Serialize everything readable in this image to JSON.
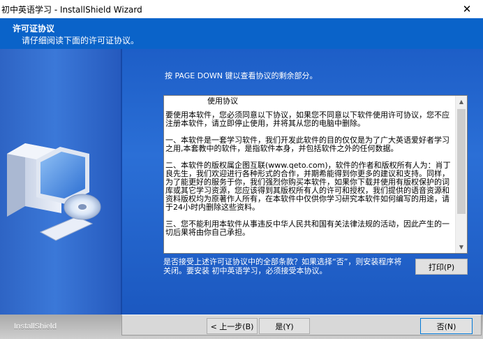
{
  "window": {
    "title": "初中英语学习 - InstallShield Wizard",
    "close_glyph": "✕"
  },
  "header": {
    "title": "许可证协议",
    "subtitle": "请仔细阅读下面的许可证协议。"
  },
  "main": {
    "instruction": "按 PAGE DOWN 键以查看协议的剩余部分。",
    "license": {
      "heading": "使用协议",
      "paragraphs": [
        "要使用本软件，您必须同意以下协议，如果您不同意以下软件使用许可协议，您不应注册本软件，请立即停止使用，并将其从您的电脑中删除。",
        "一、本软件是一套学习软件，我们开发此软件的目的仅仅是为了广大英语爱好者学习之用,本套教中的软件，是指软件本身，并包括软件之外的任何数据。",
        "二、本软件的版权属企图互联(www.qeto.com)，软件的作者和版权所有人为：肖丁良先生，我们欢迎进行各种形式的合作，并期希能得到你更多的建议和支持。同样，为了能更好的服务于你，我们强烈你购买本软件，如果你下载并使用有版权保护的词库或其它学习资源，您应该得到其版权所有人的许可和授权，我们提供的语音资源和资料版权均为原著作人所有，在本软件中仅供你学习研究本软件如何编写的用途，请于24小时内删除这些资料。",
        "三、您不能利用本软件从事违反中华人民共和国有关法律法规的活动，因此产生的一切后果将由你自己承担。"
      ]
    },
    "question": "是否接受上述许可证协议中的全部条款？如果选择“否”，则安装程序将关闭。要安装 初中英语学习，必须接受本协议。",
    "print_label": "打印(P)"
  },
  "footer": {
    "brand": "InstallShield",
    "back_label": "< 上一步(B)",
    "yes_label": "是(Y)",
    "no_label": "否(N)"
  },
  "colors": {
    "header_blue": "#0a63c9",
    "body_blue": "#2b6fd6",
    "footer_gray": "#bfbfbf"
  }
}
